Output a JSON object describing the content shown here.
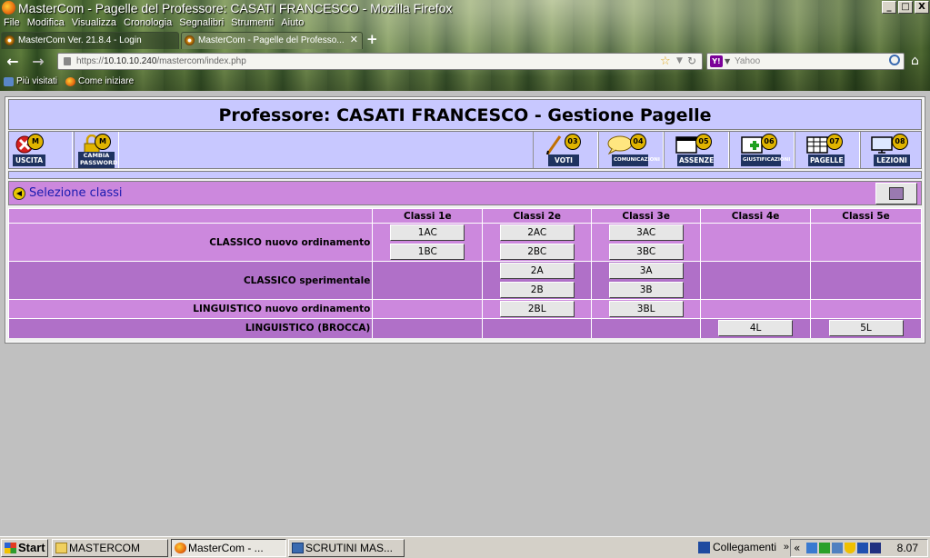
{
  "browser": {
    "window_title": "MasterCom - Pagelle del Professore: CASATI FRANCESCO - Mozilla Firefox",
    "window_buttons": [
      "_",
      "□",
      "X"
    ],
    "menu": [
      "File",
      "Modifica",
      "Visualizza",
      "Cronologia",
      "Segnalibri",
      "Strumenti",
      "Aiuto"
    ],
    "tabs": [
      {
        "label": "MasterCom Ver. 21.8.4 - Login"
      },
      {
        "label": "MasterCom - Pagelle del Professo..."
      }
    ],
    "new_tab": "+",
    "url_prefix": "https://",
    "url_host": "10.10.10.240",
    "url_path": "/mastercom/index.php",
    "search_placeholder": "Yahoo",
    "bookmarks": [
      "Più visitati",
      "Come iniziare"
    ]
  },
  "header": {
    "title": "Professore: CASATI FRANCESCO - Gestione Pagelle"
  },
  "toolbar": {
    "left": [
      {
        "label": "USCITA",
        "badge": "M",
        "icon": "exit-icon"
      },
      {
        "label": "CAMBIA PASSWORD",
        "badge": "M",
        "icon": "lock-icon"
      }
    ],
    "right": [
      {
        "label": "VOTI",
        "badge": "03",
        "icon": "pencil-icon"
      },
      {
        "label": "COMUNICAZIONI",
        "badge": "04",
        "icon": "speech-bubble-icon"
      },
      {
        "label": "ASSENZE",
        "badge": "05",
        "icon": "register-icon"
      },
      {
        "label": "GIUSTIFICAZIONI",
        "badge": "06",
        "icon": "justification-icon"
      },
      {
        "label": "PAGELLE",
        "badge": "07",
        "icon": "report-card-icon"
      },
      {
        "label": "LEZIONI",
        "badge": "08",
        "icon": "monitor-icon"
      }
    ]
  },
  "section": {
    "title": "Selezione classi"
  },
  "grid": {
    "columns": [
      "Classi 1e",
      "Classi 2e",
      "Classi 3e",
      "Classi 4e",
      "Classi 5e"
    ],
    "groups": [
      {
        "label": "CLASSICO nuovo ordinamento",
        "rows": [
          [
            "1AC",
            "2AC",
            "3AC",
            "",
            ""
          ],
          [
            "1BC",
            "2BC",
            "3BC",
            "",
            ""
          ]
        ]
      },
      {
        "label": "CLASSICO sperimentale",
        "rows": [
          [
            "",
            "2A",
            "3A",
            "",
            ""
          ],
          [
            "",
            "2B",
            "3B",
            "",
            ""
          ]
        ]
      },
      {
        "label": "LINGUISTICO nuovo ordinamento",
        "rows": [
          [
            "",
            "2BL",
            "3BL",
            "",
            ""
          ]
        ]
      },
      {
        "label": "LINGUISTICO (BROCCA)",
        "rows": [
          [
            "",
            "",
            "",
            "4L",
            "5L"
          ]
        ]
      }
    ]
  },
  "taskbar": {
    "start": "Start",
    "items": [
      {
        "label": "MASTERCOM",
        "pressed": false
      },
      {
        "label": "MasterCom - ...",
        "pressed": true
      },
      {
        "label": "SCRUTINI MAS...",
        "pressed": false
      }
    ],
    "links": "Collegamenti",
    "links_chevron": "»",
    "tray_chevron": "«",
    "clock": "8.07"
  },
  "colors": {
    "header_bg": "#c8c8ff",
    "row_light": "#cc88dd",
    "row_dark": "#b070c8",
    "section_title": "#1a1ab0"
  }
}
